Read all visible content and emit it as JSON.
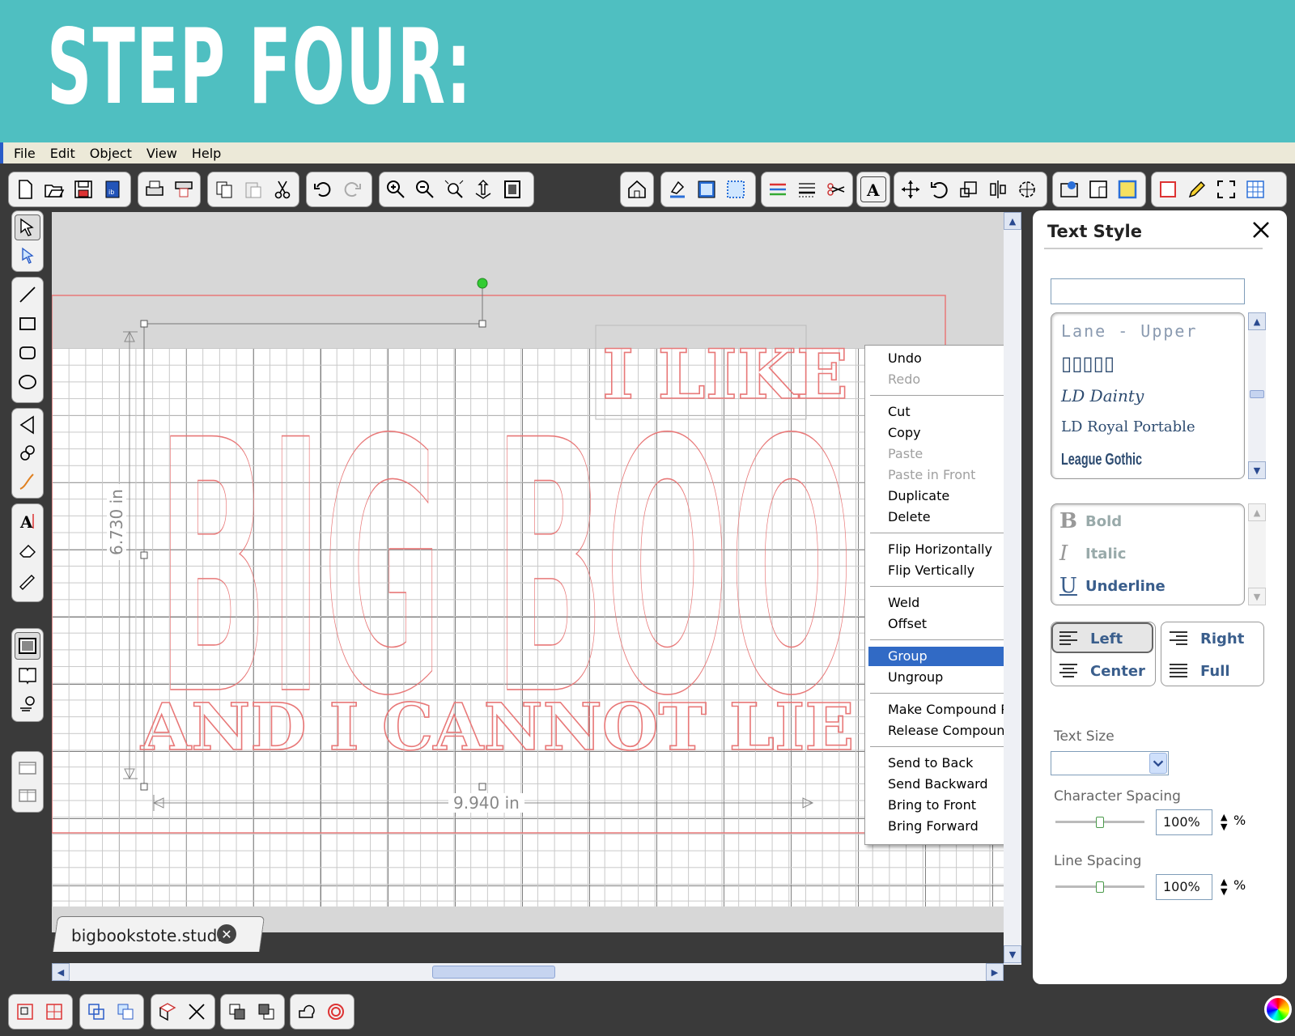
{
  "banner": {
    "title": "STEP FOUR:"
  },
  "menubar": {
    "items": [
      "File",
      "Edit",
      "Object",
      "View",
      "Help"
    ]
  },
  "canvas": {
    "dimension_height": "6.730 in",
    "dimension_width": "9.940 in",
    "design_text": {
      "line1": "I LIKE",
      "line2": "BIG BOOKS",
      "line3": "AND I CANNOT LIE"
    },
    "design_color": "#e87878"
  },
  "context_menu": {
    "items": [
      {
        "label": "Undo",
        "enabled": true
      },
      {
        "label": "Redo",
        "enabled": false
      },
      {
        "label": "Cut",
        "enabled": true
      },
      {
        "label": "Copy",
        "enabled": true
      },
      {
        "label": "Paste",
        "enabled": false
      },
      {
        "label": "Paste in Front",
        "enabled": false
      },
      {
        "label": "Duplicate",
        "enabled": true
      },
      {
        "label": "Delete",
        "enabled": true
      },
      {
        "label": "Flip Horizontally",
        "enabled": true
      },
      {
        "label": "Flip Vertically",
        "enabled": true
      },
      {
        "label": "Weld",
        "enabled": true
      },
      {
        "label": "Offset",
        "enabled": true
      },
      {
        "label": "Group",
        "enabled": true,
        "selected": true
      },
      {
        "label": "Ungroup",
        "enabled": true
      },
      {
        "label": "Make Compound Path",
        "enabled": true
      },
      {
        "label": "Release Compound Path",
        "enabled": true
      },
      {
        "label": "Send to Back",
        "enabled": true
      },
      {
        "label": "Send Backward",
        "enabled": true
      },
      {
        "label": "Bring to Front",
        "enabled": true
      },
      {
        "label": "Bring Forward",
        "enabled": true
      }
    ],
    "selected_color": "#316ac5"
  },
  "document_tab": {
    "label": "bigbookstote.studio",
    "close": "✕"
  },
  "text_style_panel": {
    "title": "Text Style",
    "search_value": "",
    "fonts": [
      "Lane - Upper",
      "▯▯▯▯▯",
      "LD Dainty",
      "LD Royal Portable",
      "League Gothic"
    ],
    "styles": [
      {
        "glyph": "B",
        "label": "Bold"
      },
      {
        "glyph": "I",
        "label": "Italic"
      },
      {
        "glyph": "U",
        "label": "Underline"
      }
    ],
    "alignment": {
      "left": "Left",
      "center": "Center",
      "right": "Right",
      "full": "Full",
      "selected": "Left"
    },
    "text_size_label": "Text Size",
    "text_size_value": "",
    "character_spacing_label": "Character Spacing",
    "character_spacing_value": "100%",
    "line_spacing_label": "Line Spacing",
    "line_spacing_value": "100%",
    "percent_sign": "%"
  },
  "icons": {
    "toolbar": [
      "new-file-icon",
      "open-folder-icon",
      "save-icon",
      "library-icon",
      "print-icon",
      "cut-send-icon",
      "copy-icon",
      "paste-icon",
      "scissors-icon",
      "undo-icon",
      "redo-icon",
      "zoom-in-icon",
      "zoom-out-icon",
      "zoom-fit-icon",
      "pan-icon",
      "page-icon",
      "home-icon",
      "fill-icon",
      "line-color-icon",
      "fill-pattern-icon",
      "line-style-icon",
      "line-weight-icon",
      "cut-settings-icon",
      "text-icon",
      "move-icon",
      "rotate-icon",
      "scale-icon",
      "align-icon",
      "replicate-icon",
      "modify-icon",
      "trace-icon",
      "page-setup-icon",
      "grid-icon",
      "draw-icon",
      "fullscreen-icon",
      "table-icon"
    ]
  }
}
